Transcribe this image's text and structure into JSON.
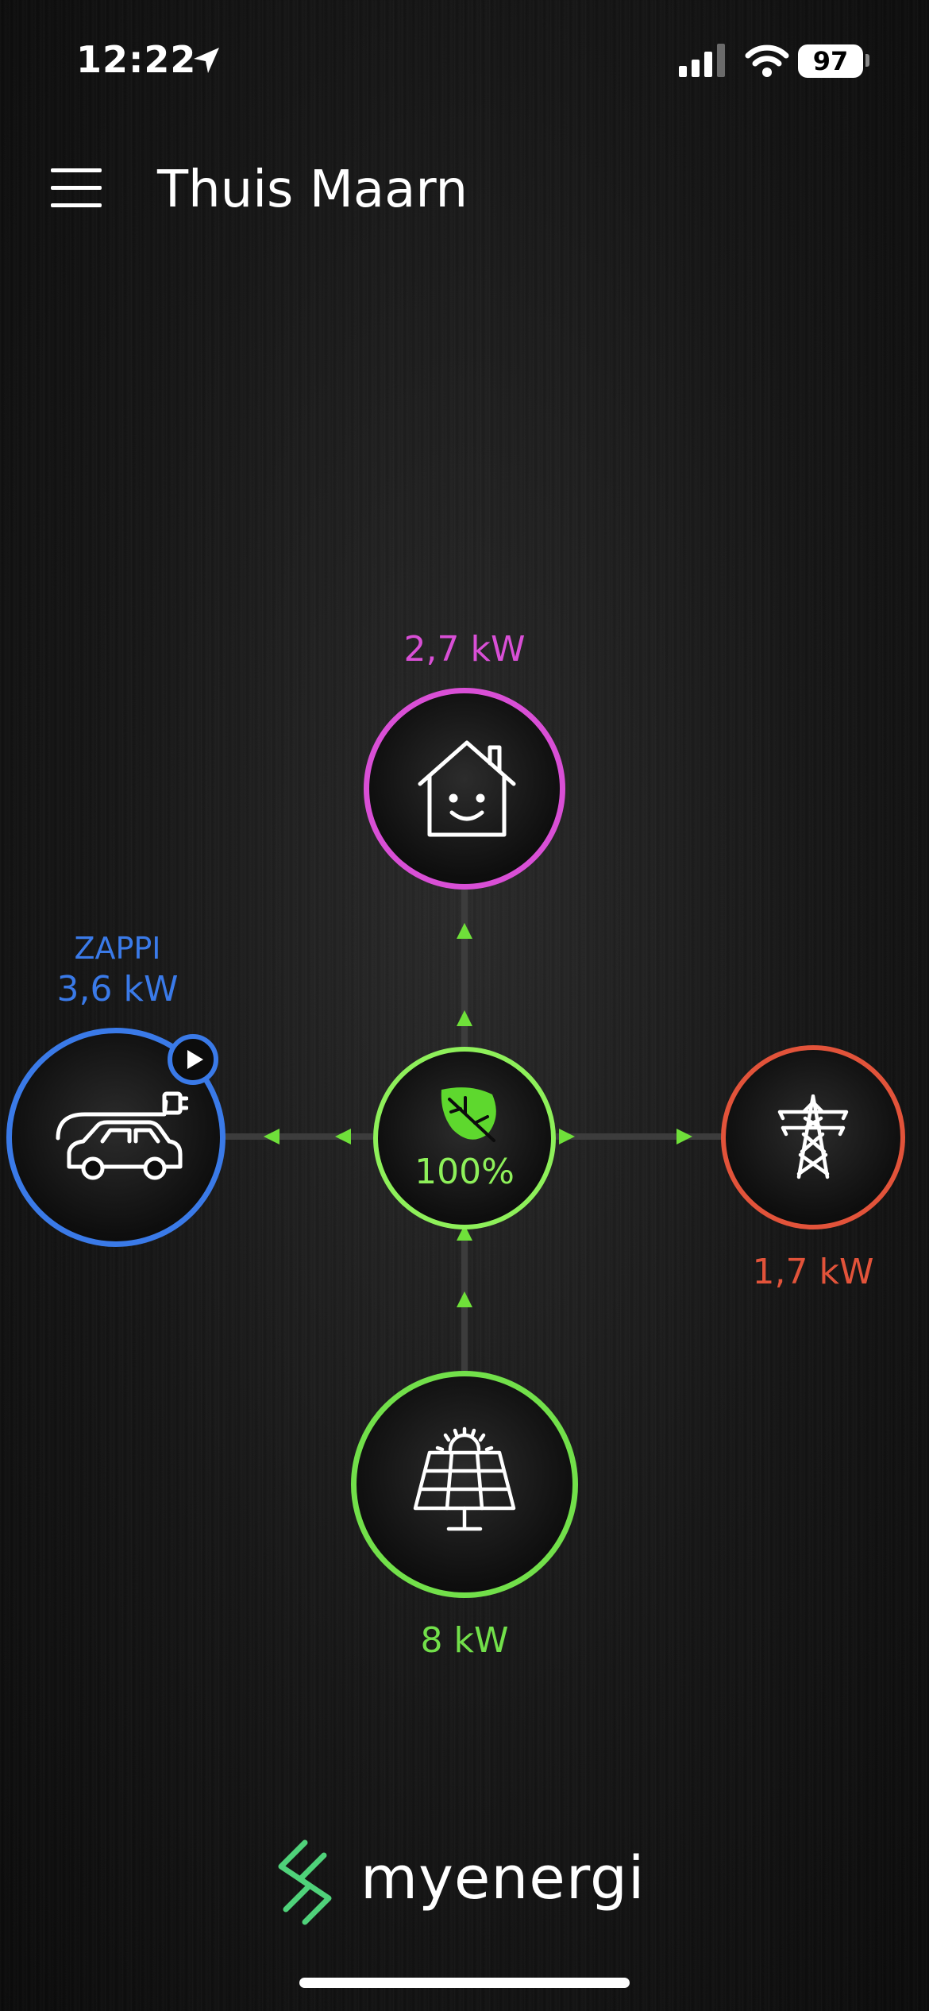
{
  "status_bar": {
    "time": "12:22",
    "battery": "97"
  },
  "header": {
    "title": "Thuis Maarn"
  },
  "flow": {
    "home": {
      "value": "2,7 kW",
      "color": "#d94fd6"
    },
    "zappi": {
      "label": "ZAPPI",
      "value": "3,6 kW",
      "color": "#3a7ae8"
    },
    "grid": {
      "value": "1,7 kW",
      "color": "#e2533a"
    },
    "solar": {
      "value": "8 kW",
      "color": "#72e04a"
    },
    "green_level": {
      "value": "100%",
      "color": "#8ef05a"
    }
  },
  "brand": {
    "name": "myenergi"
  }
}
